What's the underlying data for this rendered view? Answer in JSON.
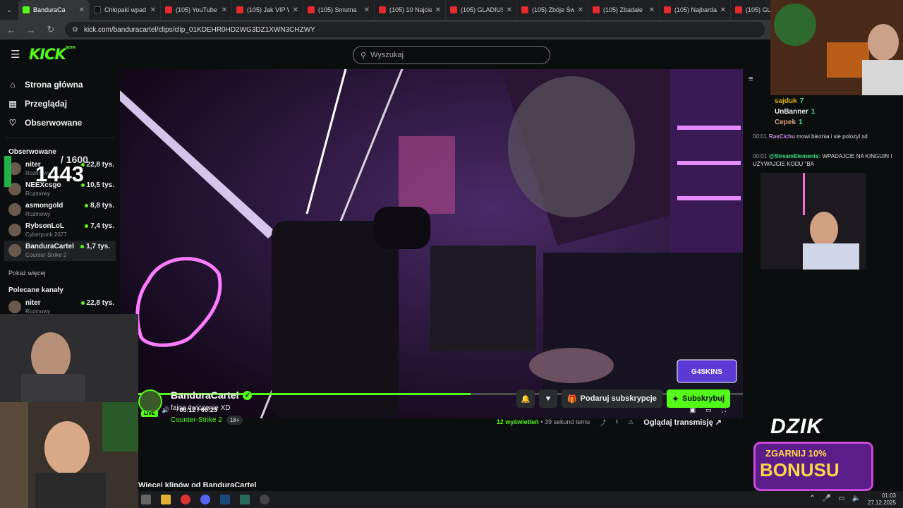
{
  "browser": {
    "tabs": [
      {
        "label": "BanduraCa",
        "icon": "kick"
      },
      {
        "label": "Chłopaki wpad",
        "icon": "tiktok"
      },
      {
        "label": "(105) YouTube",
        "icon": "youtube"
      },
      {
        "label": "(105) Jak VIP W",
        "icon": "youtube"
      },
      {
        "label": "(105) Smutna",
        "icon": "youtube"
      },
      {
        "label": "(105) 10 Najcie",
        "icon": "youtube"
      },
      {
        "label": "(105) GLADIUS",
        "icon": "youtube"
      },
      {
        "label": "(105) Zbóje Św",
        "icon": "youtube"
      },
      {
        "label": "(105) Zbadałe",
        "icon": "youtube"
      },
      {
        "label": "(105) Najbarda",
        "icon": "youtube"
      },
      {
        "label": "(105) GLAD",
        "icon": "youtube"
      }
    ],
    "url": "kick.com/banduracartel/clips/clip_01KDEHR0HD2WG3DZ1XWN3CHZWY"
  },
  "header": {
    "logo": "KICK",
    "logo_sup": "BETA",
    "search_placeholder": "Wyszukaj"
  },
  "sidebar": {
    "nav": [
      {
        "label": "Strona główna",
        "icon": "home-icon"
      },
      {
        "label": "Przeglądaj",
        "icon": "browse-icon"
      },
      {
        "label": "Obserwowane",
        "icon": "heart-icon"
      }
    ],
    "followed_heading": "Obserwowane",
    "followed": [
      {
        "name": "niter",
        "category": "Rozmowy",
        "viewers": "22,8 tys."
      },
      {
        "name": "NEEXcsgo",
        "category": "Rozmowy",
        "viewers": "10,5 tys."
      },
      {
        "name": "asmongold",
        "category": "Rozmowy",
        "viewers": "8,8 tys."
      },
      {
        "name": "RybsonLoL",
        "category": "Cyberpunk 2077",
        "viewers": "7,4 tys."
      },
      {
        "name": "BanduraCartel",
        "category": "Counter-Strike 2",
        "viewers": "1,7 tys."
      }
    ],
    "show_more": "Pokaż więcej",
    "recommended_heading": "Polecane kanały",
    "recommended": [
      {
        "name": "niter",
        "category": "Rozmowy",
        "viewers": "22,8 tys."
      }
    ]
  },
  "overlay_counter": {
    "current": "1443",
    "goal": "/ 1600"
  },
  "player": {
    "time": "00:12 / 00:23",
    "progress": 0.55,
    "sponsor": "G4SKINS"
  },
  "clip": {
    "channel": "BanduraCartel",
    "live": "LIVE",
    "title": "fajne ćwiczenie XD",
    "category": "Counter-Strike 2",
    "age": "18+",
    "gift_label": "Podaruj subskrypcje",
    "subscribe_label": "Subskrybuj",
    "views_count": "12",
    "views_label": "wyświetleń",
    "time_ago": "• 39 sekund temu",
    "watch_label": "Oglądaj transmisję",
    "more_clips": "Więcej klipów od BanduraCartel"
  },
  "chat": {
    "top_subs": [
      {
        "rank": "1",
        "name": "sajduk",
        "count": "7"
      },
      {
        "name": "UnBanner",
        "count": "1"
      },
      {
        "name": "Cepek",
        "count": "1"
      }
    ],
    "messages": [
      {
        "time": "00:01",
        "user": "RasCichu",
        "text": "mowi bieznia i sie polozyl xd"
      },
      {
        "time": "00:01",
        "user": "@StreamElements:",
        "text": "WPADAJCIE NA KINGUIN I UŻYWAJCIE KODU \"BA"
      }
    ]
  },
  "ad": {
    "brand": "DZIK",
    "line1": "ZGARNIJ 10%",
    "line2": "BONUSU"
  },
  "taskbar": {
    "time": "01:03",
    "date": "27.12.2025"
  }
}
